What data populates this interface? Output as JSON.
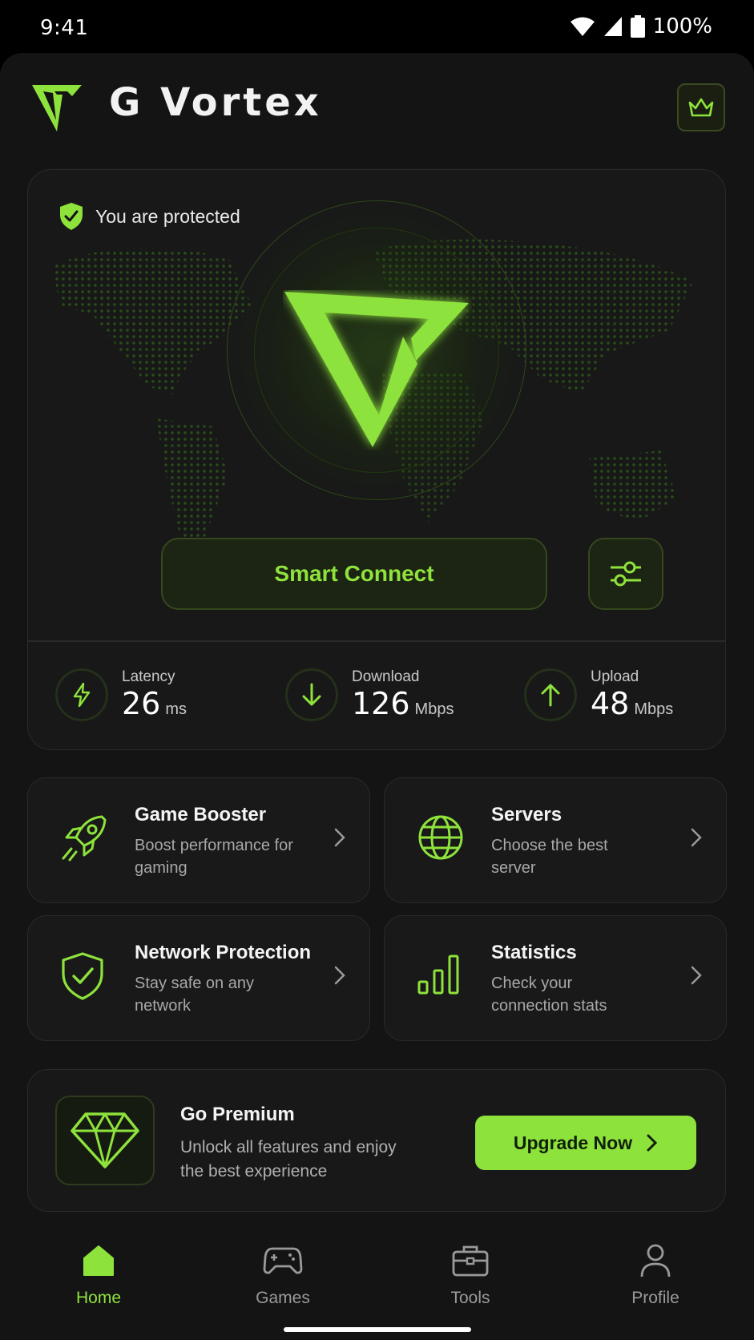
{
  "status_bar": {
    "time": "9:41",
    "battery": "100%"
  },
  "header": {
    "app_name": "G Vortex",
    "premium_icon": "crown-icon"
  },
  "hero": {
    "status_text": "You are protected",
    "connect_label": "Smart Connect",
    "settings_icon": "sliders-icon",
    "stats": [
      {
        "label": "Latency",
        "value": "26",
        "unit": "ms",
        "icon": "bolt-icon"
      },
      {
        "label": "Download",
        "value": "126",
        "unit": "Mbps",
        "icon": "arrow-down-icon"
      },
      {
        "label": "Upload",
        "value": "48",
        "unit": "Mbps",
        "icon": "arrow-up-icon"
      }
    ]
  },
  "features": [
    {
      "title": "Game Booster",
      "subtitle": "Boost performance for gaming",
      "icon": "rocket-icon"
    },
    {
      "title": "Servers",
      "subtitle": "Choose the best server",
      "icon": "globe-icon"
    },
    {
      "title": "Network Protection",
      "subtitle": "Stay safe on any network",
      "icon": "shield-check-icon"
    },
    {
      "title": "Statistics",
      "subtitle": "Check your connection stats",
      "icon": "bar-chart-icon"
    }
  ],
  "premium": {
    "title": "Go Premium",
    "subtitle": "Unlock all features and enjoy the best experience",
    "button_label": "Upgrade Now",
    "icon": "diamond-icon"
  },
  "nav": [
    {
      "label": "Home",
      "icon": "home-icon",
      "active": true
    },
    {
      "label": "Games",
      "icon": "gamepad-icon",
      "active": false
    },
    {
      "label": "Tools",
      "icon": "briefcase-icon",
      "active": false
    },
    {
      "label": "Profile",
      "icon": "person-icon",
      "active": false
    }
  ],
  "colors": {
    "accent": "#8ee23c",
    "background": "#141414",
    "card": "#191919"
  }
}
